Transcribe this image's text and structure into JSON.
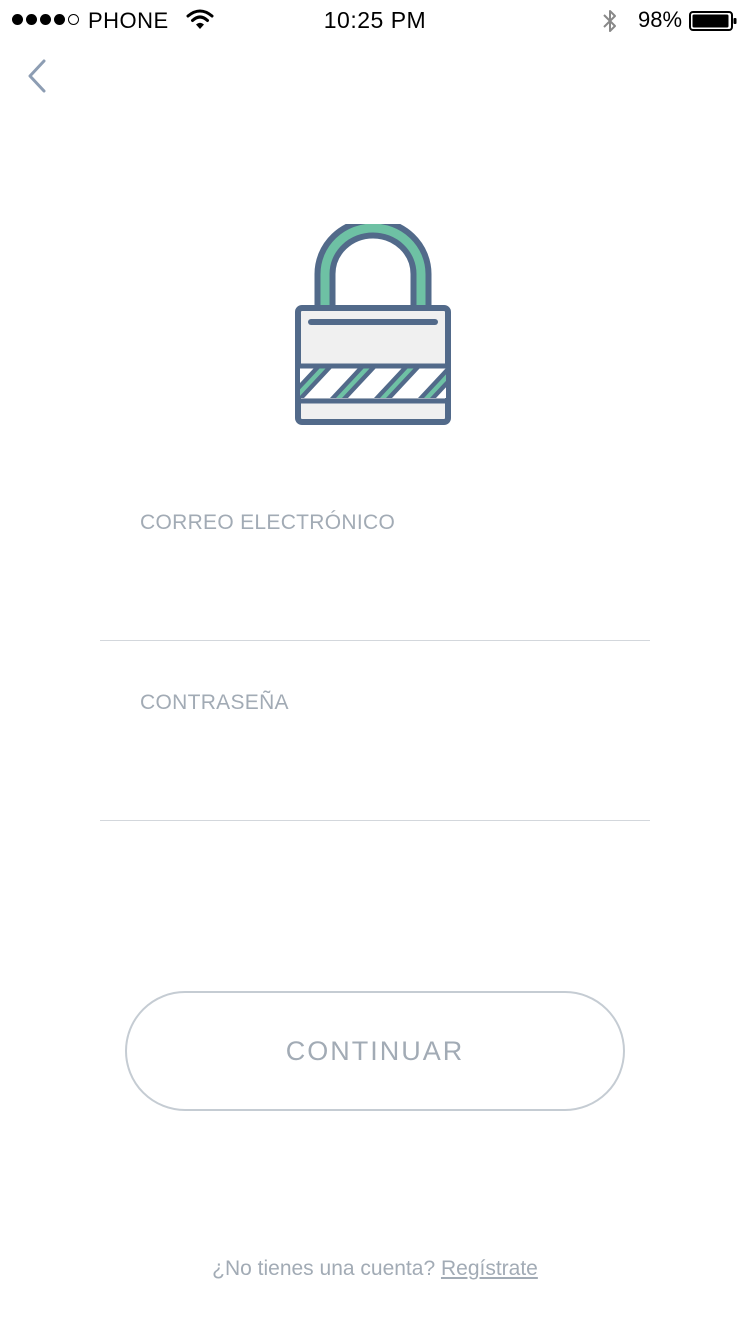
{
  "status_bar": {
    "carrier": "PHONE",
    "time": "10:25 PM",
    "battery_percent": "98%",
    "signal_bars": 4,
    "signal_total": 5
  },
  "nav": {
    "back_icon": "chevron-left-icon"
  },
  "hero": {
    "icon": "padlock-icon",
    "colors": {
      "outline": "#526a8a",
      "shackle": "#6ec1a4",
      "body_fill": "#f0f0f0"
    }
  },
  "form": {
    "email": {
      "label": "CORREO ELECTRÓNICO",
      "value": ""
    },
    "password": {
      "label": "CONTRASEÑA",
      "value": ""
    }
  },
  "actions": {
    "continue_label": "CONTINUAR"
  },
  "footer": {
    "prompt": "¿No tienes una cuenta?",
    "register_link": "Regístrate"
  },
  "colors": {
    "muted_text": "#a2abb5",
    "divider": "#d3d7dc",
    "button_border": "#c5ccd3",
    "back_arrow": "#8d9db3"
  }
}
